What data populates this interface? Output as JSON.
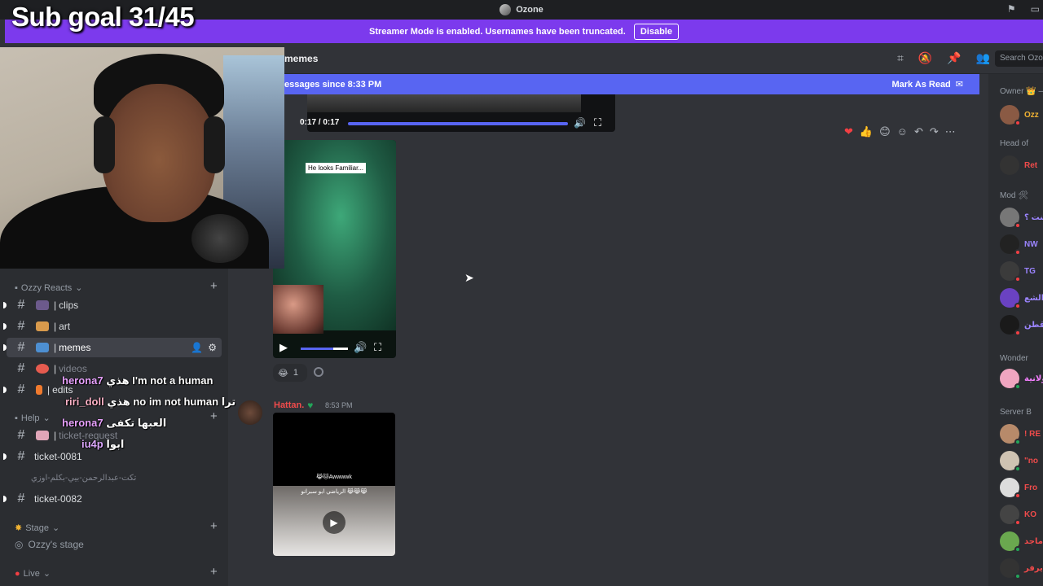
{
  "overlay": {
    "sub_goal": "Sub goal 31/45"
  },
  "titlebar": {
    "server_name": "Ozone"
  },
  "banner": {
    "text": "Streamer Mode is enabled. Usernames have been truncated.",
    "disable_label": "Disable"
  },
  "header": {
    "channel_name": "memes",
    "search_placeholder": "Search Ozo"
  },
  "new_messages": {
    "text": "essages since 8:33 PM",
    "mark_read": "Mark As Read"
  },
  "sidebar": {
    "category": "Ozzy Reacts",
    "channels": [
      {
        "label": "clips"
      },
      {
        "label": "art"
      },
      {
        "label": "memes"
      },
      {
        "label": "videos"
      },
      {
        "label": "edits"
      }
    ],
    "help_category": "Help",
    "ticket_request": "ticket-request",
    "tickets": [
      "ticket-0081",
      "تكت-عبدالرحمن-بيي-بكلم-اوزي",
      "ticket-0082"
    ],
    "stage_category": "Stage",
    "stage_channel": "Ozzy's stage",
    "live_category": "Live"
  },
  "chat_overlay": [
    {
      "user": "herona7",
      "text": "هذي I'm not a human"
    },
    {
      "user": "riri_doll",
      "text": "هذي no im not human ترا"
    },
    {
      "user": "herona7",
      "text": "العبها تكفى"
    },
    {
      "user": "iu4p",
      "text": "ابوا"
    }
  ],
  "messages": {
    "video1_time": "0:17 / 0:17",
    "video2_caption": "He looks Familiar...",
    "reaction_count": "1",
    "msg2_author": "Hattan.",
    "msg2_time": "8:53 PM",
    "video3_title": "😹🐱Awwwwk",
    "video3_sub": "الرياضي ابو سبرانو 😹😹😹"
  },
  "members": {
    "roles": [
      "Owner 👑 —",
      "Head of",
      "Mod 🛠",
      "Wonder",
      "Server B"
    ],
    "names": [
      "Ozz",
      "Ret",
      "جنت ؟",
      "NW",
      "TG",
      "الشع",
      "قطن",
      "ولانية",
      "! RE",
      "\"no",
      "Fro",
      "KO",
      "ماجد",
      "يرفر"
    ]
  }
}
